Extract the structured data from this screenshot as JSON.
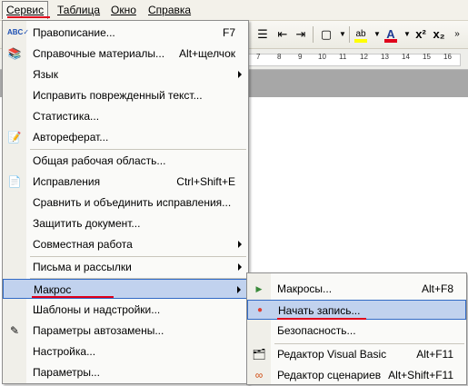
{
  "menubar": {
    "items": [
      "Сервис",
      "Таблица",
      "Окно",
      "Справка"
    ]
  },
  "toolbar": {
    "icons": [
      "bullet-list-icon",
      "indent-icon",
      "border-icon",
      "highlight-icon",
      "font-color-icon",
      "superscript-icon",
      "subscript-icon"
    ],
    "highlight_label": "ab",
    "font_color_label": "A",
    "superscript_label": "x²",
    "subscript_label": "x₂"
  },
  "ruler": {
    "ticks": [
      "7",
      "8",
      "9",
      "10",
      "11",
      "12",
      "13",
      "14",
      "15",
      "16"
    ]
  },
  "service_menu": {
    "items": [
      {
        "label": "Правописание...",
        "shortcut": "F7",
        "icon": "spelling-icon"
      },
      {
        "label": "Справочные материалы...",
        "shortcut": "Alt+щелчок",
        "icon": "research-icon"
      },
      {
        "label": "Язык",
        "submenu": true
      },
      {
        "label": "Исправить поврежденный текст..."
      },
      {
        "label": "Статистика..."
      },
      {
        "label": "Автореферат...",
        "icon": "autosummary-icon"
      },
      {
        "label": "Общая рабочая область..."
      },
      {
        "label": "Исправления",
        "shortcut": "Ctrl+Shift+E",
        "icon": "track-changes-icon"
      },
      {
        "label": "Сравнить и объединить исправления..."
      },
      {
        "label": "Защитить документ..."
      },
      {
        "label": "Совместная работа",
        "submenu": true
      },
      {
        "label": "Письма и рассылки",
        "submenu": true
      },
      {
        "label": "Макрос",
        "submenu": true,
        "highlighted": true
      },
      {
        "label": "Шаблоны и надстройки..."
      },
      {
        "label": "Параметры автозамены...",
        "icon": "autocorrect-icon"
      },
      {
        "label": "Настройка..."
      },
      {
        "label": "Параметры..."
      }
    ]
  },
  "macro_submenu": {
    "items": [
      {
        "label": "Макросы...",
        "shortcut": "Alt+F8",
        "icon": "play-icon"
      },
      {
        "label": "Начать запись...",
        "icon": "record-icon",
        "highlighted": true
      },
      {
        "label": "Безопасность..."
      },
      {
        "label": "Редактор Visual Basic",
        "shortcut": "Alt+F11",
        "icon": "vb-editor-icon"
      },
      {
        "label": "Редактор сценариев",
        "shortcut": "Alt+Shift+F11",
        "icon": "script-editor-icon"
      }
    ]
  },
  "colors": {
    "highlight_bg": "#c1d2ee",
    "highlight_border": "#316ac5",
    "annotation_red": "#e0001b"
  }
}
